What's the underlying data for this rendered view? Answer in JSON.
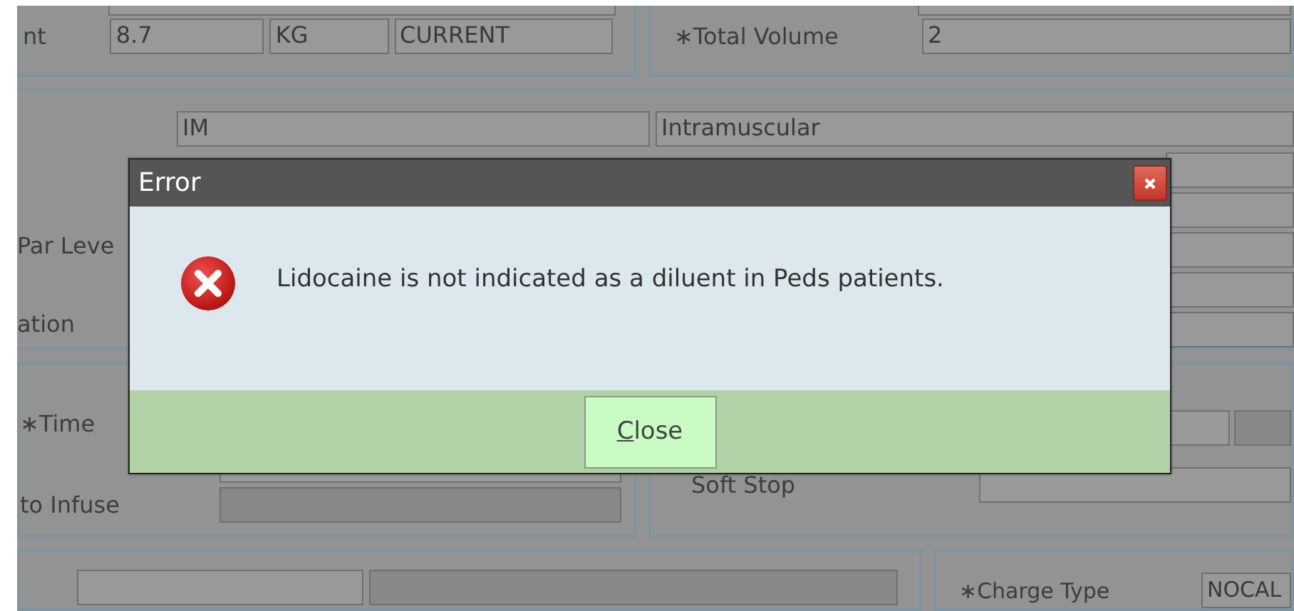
{
  "form": {
    "weight": {
      "label": "nt",
      "value": "8.7",
      "unit": "KG",
      "status": "CURRENT"
    },
    "total_volume": {
      "label": "∗Total Volume",
      "value": "2"
    },
    "route": {
      "code": "IM",
      "name": "Intramuscular"
    },
    "section_2_labels": [
      "Par Leve",
      "ation"
    ],
    "time": {
      "label": "∗Time"
    },
    "infuse": {
      "label": "to Infuse"
    },
    "soft_stop": {
      "label": "Soft Stop"
    },
    "charge_type": {
      "label": "∗Charge Type",
      "value": "NOCAL"
    }
  },
  "dialog": {
    "title": "Error",
    "message": "Lidocaine is not indicated as a diluent in Peds patients.",
    "buttons": [
      {
        "label": "Close",
        "underline_first": true
      }
    ]
  }
}
